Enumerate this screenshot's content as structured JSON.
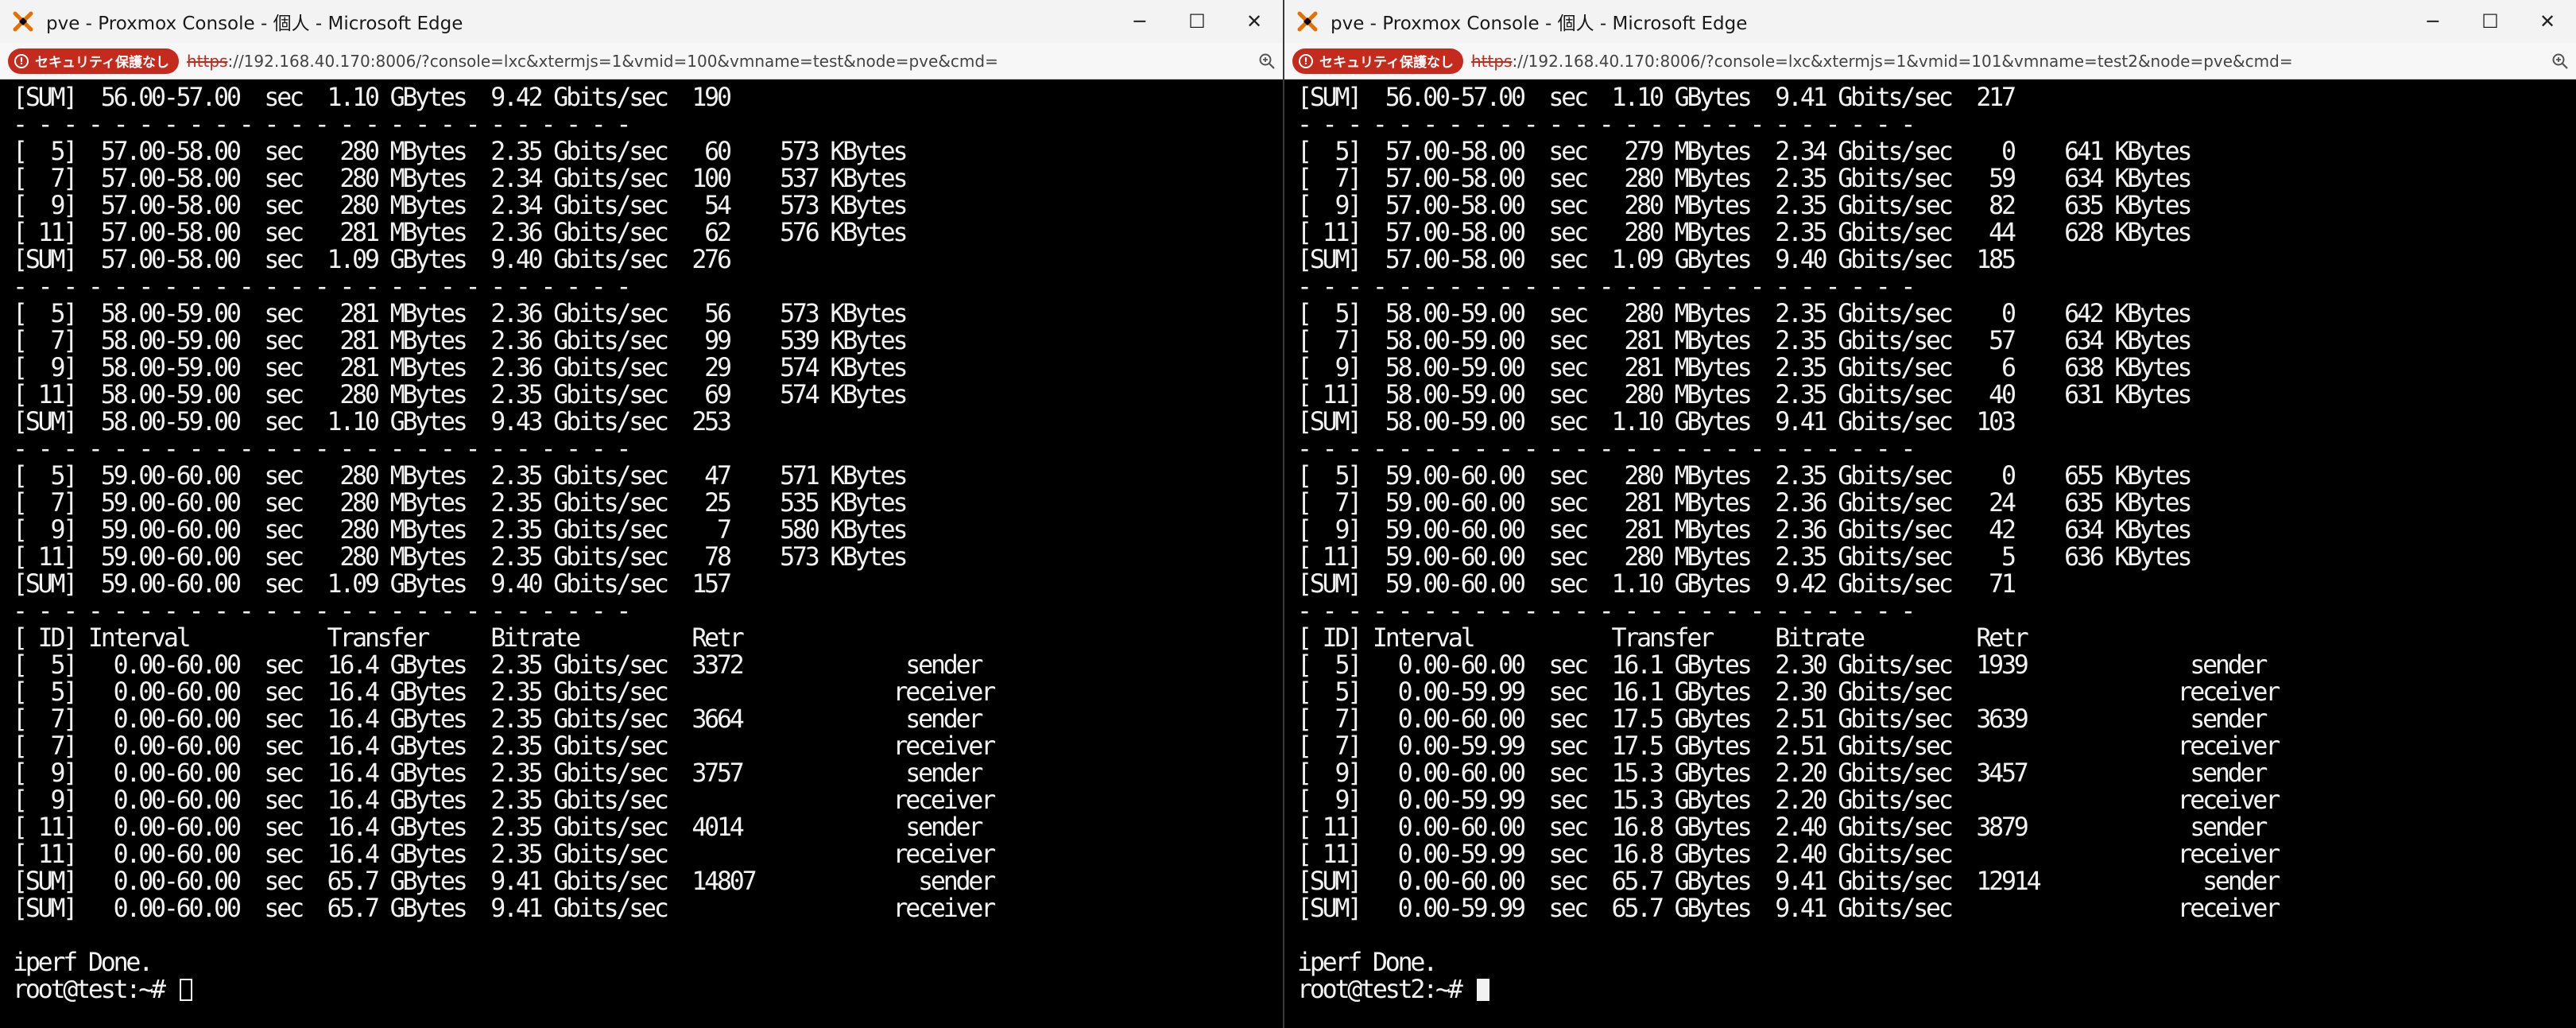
{
  "left": {
    "title": "pve - Proxmox Console - 個人 - Microsoft Edge",
    "security_badge": "セキュリティ保護なし",
    "url_scheme": "https",
    "url_rest": "://192.168.40.170:8006/?console=lxc&xtermjs=1&vmid=100&vmname=test&node=pve&cmd=",
    "lines": [
      "[SUM]  56.00-57.00  sec  1.10 GBytes  9.42 Gbits/sec  190",
      "- - - - - - - - - - - - - - - - - - - - - - - - -",
      "[  5]  57.00-58.00  sec   280 MBytes  2.35 Gbits/sec   60    573 KBytes",
      "[  7]  57.00-58.00  sec   280 MBytes  2.34 Gbits/sec  100    537 KBytes",
      "[  9]  57.00-58.00  sec   280 MBytes  2.34 Gbits/sec   54    573 KBytes",
      "[ 11]  57.00-58.00  sec   281 MBytes  2.36 Gbits/sec   62    576 KBytes",
      "[SUM]  57.00-58.00  sec  1.09 GBytes  9.40 Gbits/sec  276",
      "- - - - - - - - - - - - - - - - - - - - - - - - -",
      "[  5]  58.00-59.00  sec   281 MBytes  2.36 Gbits/sec   56    573 KBytes",
      "[  7]  58.00-59.00  sec   281 MBytes  2.36 Gbits/sec   99    539 KBytes",
      "[  9]  58.00-59.00  sec   281 MBytes  2.36 Gbits/sec   29    574 KBytes",
      "[ 11]  58.00-59.00  sec   280 MBytes  2.35 Gbits/sec   69    574 KBytes",
      "[SUM]  58.00-59.00  sec  1.10 GBytes  9.43 Gbits/sec  253",
      "- - - - - - - - - - - - - - - - - - - - - - - - -",
      "[  5]  59.00-60.00  sec   280 MBytes  2.35 Gbits/sec   47    571 KBytes",
      "[  7]  59.00-60.00  sec   280 MBytes  2.35 Gbits/sec   25    535 KBytes",
      "[  9]  59.00-60.00  sec   280 MBytes  2.35 Gbits/sec    7    580 KBytes",
      "[ 11]  59.00-60.00  sec   280 MBytes  2.35 Gbits/sec   78    573 KBytes",
      "[SUM]  59.00-60.00  sec  1.09 GBytes  9.40 Gbits/sec  157",
      "- - - - - - - - - - - - - - - - - - - - - - - - -",
      "[ ID] Interval           Transfer     Bitrate         Retr",
      "[  5]   0.00-60.00  sec  16.4 GBytes  2.35 Gbits/sec  3372             sender",
      "[  5]   0.00-60.00  sec  16.4 GBytes  2.35 Gbits/sec                  receiver",
      "[  7]   0.00-60.00  sec  16.4 GBytes  2.35 Gbits/sec  3664             sender",
      "[  7]   0.00-60.00  sec  16.4 GBytes  2.35 Gbits/sec                  receiver",
      "[  9]   0.00-60.00  sec  16.4 GBytes  2.35 Gbits/sec  3757             sender",
      "[  9]   0.00-60.00  sec  16.4 GBytes  2.35 Gbits/sec                  receiver",
      "[ 11]   0.00-60.00  sec  16.4 GBytes  2.35 Gbits/sec  4014             sender",
      "[ 11]   0.00-60.00  sec  16.4 GBytes  2.35 Gbits/sec                  receiver",
      "[SUM]   0.00-60.00  sec  65.7 GBytes  9.41 Gbits/sec  14807             sender",
      "[SUM]   0.00-60.00  sec  65.7 GBytes  9.41 Gbits/sec                  receiver",
      "",
      "iperf Done."
    ],
    "prompt": "root@test:~# "
  },
  "right": {
    "title": "pve - Proxmox Console - 個人 - Microsoft Edge",
    "security_badge": "セキュリティ保護なし",
    "url_scheme": "https",
    "url_rest": "://192.168.40.170:8006/?console=lxc&xtermjs=1&vmid=101&vmname=test2&node=pve&cmd=",
    "lines": [
      "[SUM]  56.00-57.00  sec  1.10 GBytes  9.41 Gbits/sec  217",
      "- - - - - - - - - - - - - - - - - - - - - - - - -",
      "[  5]  57.00-58.00  sec   279 MBytes  2.34 Gbits/sec    0    641 KBytes",
      "[  7]  57.00-58.00  sec   280 MBytes  2.35 Gbits/sec   59    634 KBytes",
      "[  9]  57.00-58.00  sec   280 MBytes  2.35 Gbits/sec   82    635 KBytes",
      "[ 11]  57.00-58.00  sec   280 MBytes  2.35 Gbits/sec   44    628 KBytes",
      "[SUM]  57.00-58.00  sec  1.09 GBytes  9.40 Gbits/sec  185",
      "- - - - - - - - - - - - - - - - - - - - - - - - -",
      "[  5]  58.00-59.00  sec   280 MBytes  2.35 Gbits/sec    0    642 KBytes",
      "[  7]  58.00-59.00  sec   281 MBytes  2.35 Gbits/sec   57    634 KBytes",
      "[  9]  58.00-59.00  sec   281 MBytes  2.35 Gbits/sec    6    638 KBytes",
      "[ 11]  58.00-59.00  sec   280 MBytes  2.35 Gbits/sec   40    631 KBytes",
      "[SUM]  58.00-59.00  sec  1.10 GBytes  9.41 Gbits/sec  103",
      "- - - - - - - - - - - - - - - - - - - - - - - - -",
      "[  5]  59.00-60.00  sec   280 MBytes  2.35 Gbits/sec    0    655 KBytes",
      "[  7]  59.00-60.00  sec   281 MBytes  2.36 Gbits/sec   24    635 KBytes",
      "[  9]  59.00-60.00  sec   281 MBytes  2.36 Gbits/sec   42    634 KBytes",
      "[ 11]  59.00-60.00  sec   280 MBytes  2.35 Gbits/sec    5    636 KBytes",
      "[SUM]  59.00-60.00  sec  1.10 GBytes  9.42 Gbits/sec   71",
      "- - - - - - - - - - - - - - - - - - - - - - - - -",
      "[ ID] Interval           Transfer     Bitrate         Retr",
      "[  5]   0.00-60.00  sec  16.1 GBytes  2.30 Gbits/sec  1939             sender",
      "[  5]   0.00-59.99  sec  16.1 GBytes  2.30 Gbits/sec                  receiver",
      "[  7]   0.00-60.00  sec  17.5 GBytes  2.51 Gbits/sec  3639             sender",
      "[  7]   0.00-59.99  sec  17.5 GBytes  2.51 Gbits/sec                  receiver",
      "[  9]   0.00-60.00  sec  15.3 GBytes  2.20 Gbits/sec  3457             sender",
      "[  9]   0.00-59.99  sec  15.3 GBytes  2.20 Gbits/sec                  receiver",
      "[ 11]   0.00-60.00  sec  16.8 GBytes  2.40 Gbits/sec  3879             sender",
      "[ 11]   0.00-59.99  sec  16.8 GBytes  2.40 Gbits/sec                  receiver",
      "[SUM]   0.00-60.00  sec  65.7 GBytes  9.41 Gbits/sec  12914             sender",
      "[SUM]   0.00-59.99  sec  65.7 GBytes  9.41 Gbits/sec                  receiver",
      "",
      "iperf Done."
    ],
    "prompt": "root@test2:~# "
  },
  "controls": {
    "minimize": "─",
    "maximize": "☐",
    "close": "✕"
  }
}
